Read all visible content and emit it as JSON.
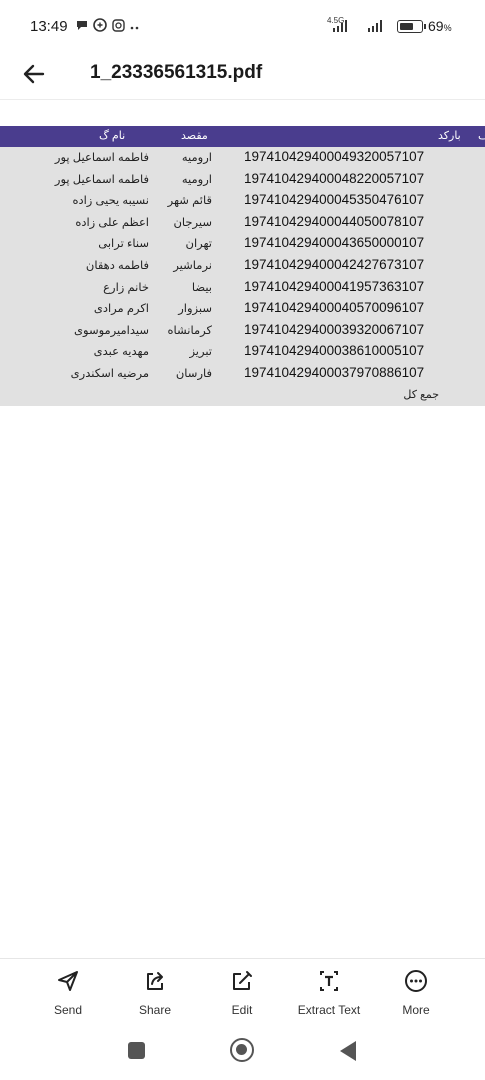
{
  "status_bar": {
    "time": "13:49",
    "network_label": "4.5G",
    "battery_percent": "69",
    "battery_percent_sign": "%",
    "battery_level": 0.69,
    "notification_icons": [
      "chat-bubble-icon",
      "app-logo-icon",
      "instagram-icon",
      "more-dots-icon"
    ]
  },
  "app_bar": {
    "file_title": "1_23336561315.pdf"
  },
  "document": {
    "header": {
      "barcode": "بارکد",
      "first_col_partial": "ف",
      "destination": "مقصد",
      "name": "نام گ"
    },
    "rows": [
      {
        "barcode": "197410429400049320057107",
        "destination": "ارومیه",
        "name": "فاطمه اسماعیل پور"
      },
      {
        "barcode": "197410429400048220057107",
        "destination": "ارومیه",
        "name": "فاطمه اسماعیل پور"
      },
      {
        "barcode": "197410429400045350476107",
        "destination": "قائم شهر",
        "name": "نسیبه یحیی زاده"
      },
      {
        "barcode": "197410429400044050078107",
        "destination": "سیرجان",
        "name": "اعظم علی زاده"
      },
      {
        "barcode": "197410429400043650000107",
        "destination": "تهران",
        "name": "سناء ترابی"
      },
      {
        "barcode": "197410429400042427673107",
        "destination": "نرماشیر",
        "name": "فاطمه دهقان"
      },
      {
        "barcode": "197410429400041957363107",
        "destination": "بیضا",
        "name": "خانم زارع"
      },
      {
        "barcode": "197410429400040570096107",
        "destination": "سبزوار",
        "name": "اکرم مرادی"
      },
      {
        "barcode": "197410429400039320067107",
        "destination": "کرمانشاه",
        "name": "سیدامیرموسوی"
      },
      {
        "barcode": "197410429400038610005107",
        "destination": "تبریز",
        "name": "مهدیه عبدی"
      },
      {
        "barcode": "197410429400037970886107",
        "destination": "فارسان",
        "name": "مرضیه اسکندری"
      }
    ],
    "total_label": "جمع کل"
  },
  "toolbar": {
    "send_label": "Send",
    "share_label": "Share",
    "edit_label": "Edit",
    "extract_text_label": "Extract Text",
    "more_label": "More"
  },
  "colors": {
    "header_bg": "#4a3d8e",
    "doc_bg": "#e1e1e1",
    "text": "#222222"
  }
}
